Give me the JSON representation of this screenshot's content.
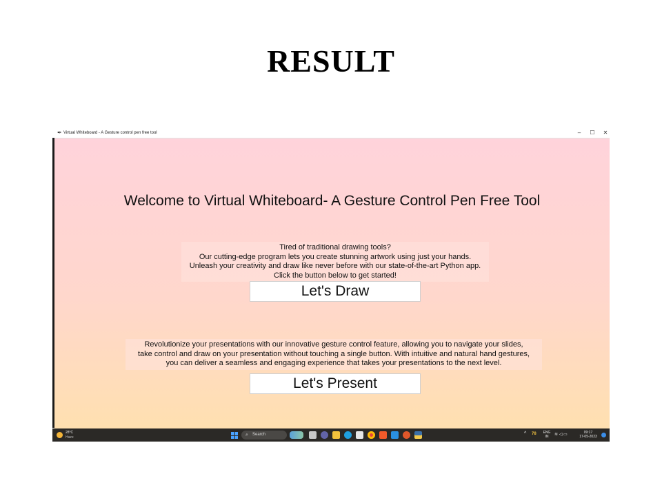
{
  "slide": {
    "title": "RESULT"
  },
  "window": {
    "title": "Virtual Whiteboard - A Gesture control pen free tool",
    "controls": {
      "minimize": "–",
      "maximize": "☐",
      "close": "✕"
    }
  },
  "app": {
    "welcome": "Welcome to Virtual Whiteboard- A Gesture Control Pen Free Tool",
    "draw_section": {
      "lines": [
        "Tired of traditional drawing tools?",
        "Our cutting-edge program lets you create stunning artwork using just your hands.",
        "Unleash your creativity and draw like never before with our state-of-the-art Python app.",
        "Click the button below to get started!"
      ],
      "button_label": "Let's Draw"
    },
    "present_section": {
      "lines": [
        "Revolutionize your presentations with our innovative gesture control feature, allowing you to navigate your slides,",
        "take control and draw on your presentation without touching a single button. With intuitive and natural hand gestures,",
        "you can deliver a seamless and engaging experience that takes your presentations to the next level."
      ],
      "button_label": "Let's Present"
    }
  },
  "taskbar": {
    "weather": {
      "temp": "28°C",
      "condition": "Haze"
    },
    "search_placeholder": "Search",
    "pinned_apps": [
      "widgets-icon",
      "file-explorer-icon",
      "teams-icon",
      "folder-icon",
      "edge-icon",
      "store-icon",
      "chrome-icon",
      "brave-icon",
      "vscode-icon",
      "firefox-icon",
      "python-icon"
    ],
    "tray": {
      "temp_badge": "78",
      "lang": "ENG",
      "region": "IN",
      "time": "09:17",
      "date": "17-05-2023"
    }
  },
  "colors": {
    "app_gradient_top": "#ffd3db",
    "app_gradient_bottom": "#ffe0b0",
    "taskbar": "#2b2926"
  }
}
